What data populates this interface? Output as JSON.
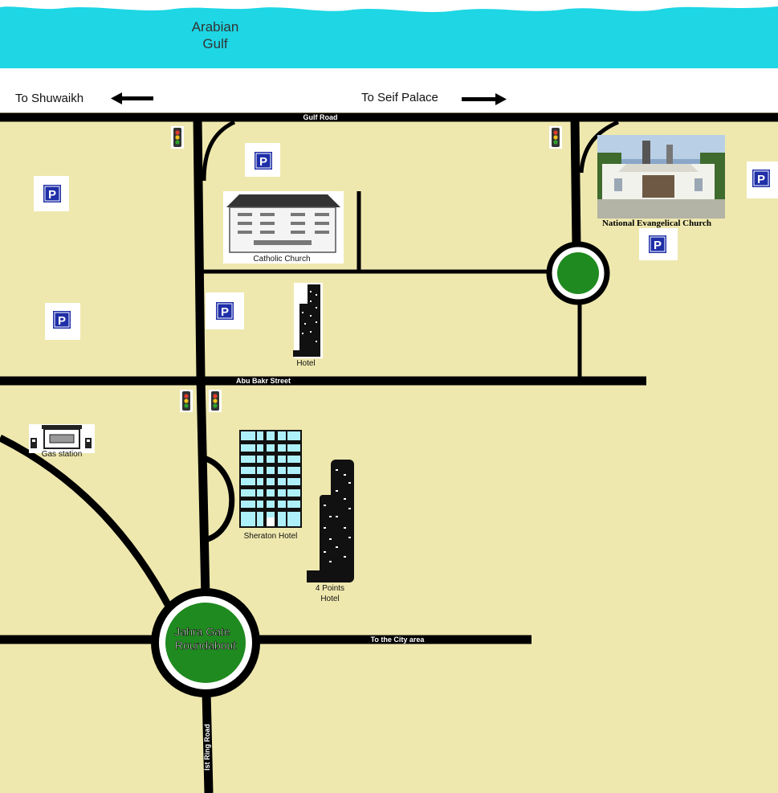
{
  "colors": {
    "sea": "#1ed6e4",
    "land": "#efe8ae",
    "road": "#000000",
    "roundabout_fill": "#1f8a1f",
    "parking_blue": "#1f2fa8",
    "sheraton_window": "#aef0fa"
  },
  "sea": {
    "name": "Arabian\nGulf",
    "line1": "Arabian",
    "line2": "Gulf"
  },
  "directions": {
    "left": {
      "label": "To Shuwaikh",
      "arrow": "arrow-left-icon"
    },
    "right": {
      "label": "To Seif Palace",
      "arrow": "arrow-right-icon"
    }
  },
  "roads": {
    "gulf_road": "Gulf Road",
    "abu_bakr_street": "Abu Bakr Street",
    "city_area": "To the City area",
    "ring_road": "Ist Ring Road"
  },
  "roundabouts": {
    "jahra_gate": {
      "line1": "Jahra Gate",
      "line2": "Roundabout"
    }
  },
  "places": {
    "catholic_church": "Catholic Church",
    "national_evangelical_church": "National Evangelical Church",
    "hotel": "Hotel",
    "gas_station": "Gas station",
    "sheraton_hotel": "Sheraton Hotel",
    "four_points_line1": "4 Points",
    "four_points_line2": "Hotel"
  },
  "icons": {
    "parking": "parking-icon",
    "traffic_light": "traffic-light-icon",
    "fuel_pump": "fuel-pump-icon"
  }
}
